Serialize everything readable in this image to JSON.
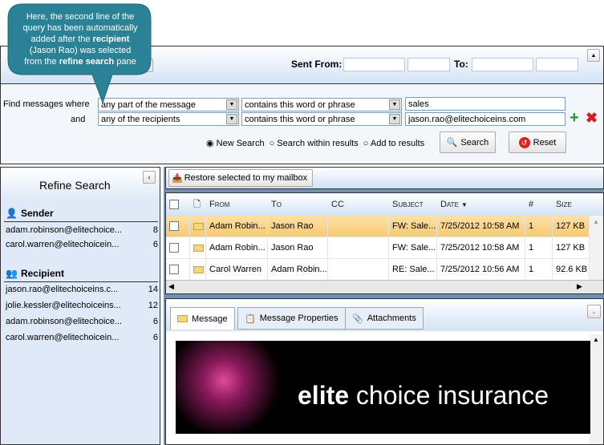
{
  "callout": {
    "line1": "Here, the second line of the",
    "line2": "query has been automatically",
    "line3a": "added after the ",
    "line3b": "recipient",
    "line4": "(Jason Rao) was selected",
    "line5a": "from the ",
    "line5b": "refine search",
    "line5c": " pane"
  },
  "top": {
    "sent_from": "Sent From:",
    "to": "To:"
  },
  "query": {
    "find_label": "Find messages where",
    "and_label": "and",
    "row1": {
      "field": "any part of the message",
      "op": "contains this word or phrase",
      "value": "sales"
    },
    "row2": {
      "field": "any of the recipients",
      "op": "contains this word or phrase",
      "value": "jason.rao@elitechoiceins.com"
    },
    "radios": [
      "New Search",
      "Search within results",
      "Add to results"
    ],
    "selected_radio": "New Search",
    "search": "Search",
    "reset": "Reset"
  },
  "refine": {
    "title": "Refine Search",
    "sender_label": "Sender",
    "senders": [
      {
        "email": "adam.robinson@elitechoice...",
        "count": "8"
      },
      {
        "email": "carol.warren@elitechoicein...",
        "count": "6"
      }
    ],
    "recipient_label": "Recipient",
    "recipients": [
      {
        "email": "jason.rao@elitechoiceins.c...",
        "count": "14"
      },
      {
        "email": "jolie.kessler@elitechoiceins...",
        "count": "12"
      },
      {
        "email": "adam.robinson@elitechoice...",
        "count": "6"
      },
      {
        "email": "carol.warren@elitechoicein...",
        "count": "6"
      }
    ]
  },
  "toolbar": {
    "restore": "Restore selected to my mailbox"
  },
  "grid": {
    "headers": [
      "From",
      "To",
      "CC",
      "Subject",
      "Date",
      "#",
      "Size"
    ],
    "rows": [
      [
        "Adam Robin...",
        "Jason Rao",
        "",
        "FW: Sale...",
        "7/25/2012 10:58 AM",
        "1",
        "127 KB"
      ],
      [
        "Adam Robin...",
        "Jason Rao",
        "",
        "FW: Sale...",
        "7/25/2012 10:58 AM",
        "1",
        "127 KB"
      ],
      [
        "Carol Warren",
        "Adam Robin...",
        "",
        "RE: Sale...",
        "7/25/2012 10:56 AM",
        "1",
        "92.6 KB"
      ]
    ]
  },
  "preview": {
    "tabs": [
      "Message",
      "Message Properties",
      "Attachments"
    ],
    "active_tab": "Message",
    "banner_bold": "elite",
    "banner_rest": " choice insurance"
  },
  "colors": {
    "callout": "#2b8296",
    "selected_row": "#fbd48a",
    "accent_bg": "#6f8fb5"
  }
}
